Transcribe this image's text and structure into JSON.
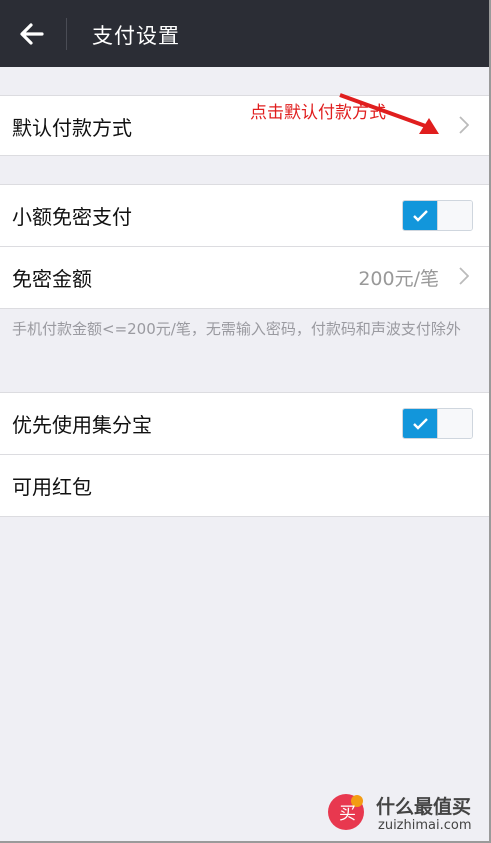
{
  "header": {
    "title": "支付设置"
  },
  "settings": {
    "default_payment": {
      "label": "默认付款方式"
    },
    "small_free": {
      "label": "小额免密支付",
      "enabled": true
    },
    "free_amount": {
      "label": "免密金额",
      "value": "200元/笔"
    },
    "note": "手机付款金额<=200元/笔，无需输入密码，付款码和声波支付除外",
    "jifenbao": {
      "label": "优先使用集分宝",
      "enabled": true
    },
    "red_packet": {
      "label": "可用红包"
    }
  },
  "annotation": {
    "text": "点击默认付款方式",
    "color": "#e01e1e"
  },
  "watermark": {
    "title": "什么最值买",
    "url": "zuizhimai.com",
    "icon_text": "买"
  },
  "colors": {
    "accent": "#1296db",
    "navbar": "#2b2d35"
  },
  "icons": {
    "back": "arrow-left-icon",
    "chevron": "chevron-right-icon",
    "check": "check-icon"
  }
}
